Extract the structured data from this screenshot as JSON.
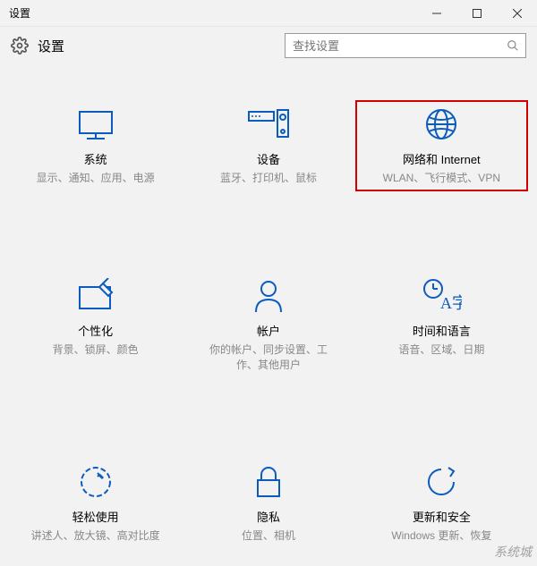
{
  "window": {
    "title": "设置"
  },
  "header": {
    "appTitle": "设置"
  },
  "search": {
    "placeholder": "查找设置"
  },
  "tiles": {
    "system": {
      "title": "系统",
      "desc": "显示、通知、应用、电源"
    },
    "devices": {
      "title": "设备",
      "desc": "蓝牙、打印机、鼠标"
    },
    "network": {
      "title": "网络和 Internet",
      "desc": "WLAN、飞行模式、VPN"
    },
    "personal": {
      "title": "个性化",
      "desc": "背景、锁屏、颜色"
    },
    "accounts": {
      "title": "帐户",
      "desc": "你的帐户、同步设置、工作、其他用户"
    },
    "time": {
      "title": "时间和语言",
      "desc": "语音、区域、日期"
    },
    "ease": {
      "title": "轻松使用",
      "desc": "讲述人、放大镜、高对比度"
    },
    "privacy": {
      "title": "隐私",
      "desc": "位置、相机"
    },
    "update": {
      "title": "更新和安全",
      "desc": "Windows 更新、恢复"
    }
  },
  "watermark": "系统城",
  "colors": {
    "accent": "#0b5cbd",
    "highlight": "#d40000"
  }
}
